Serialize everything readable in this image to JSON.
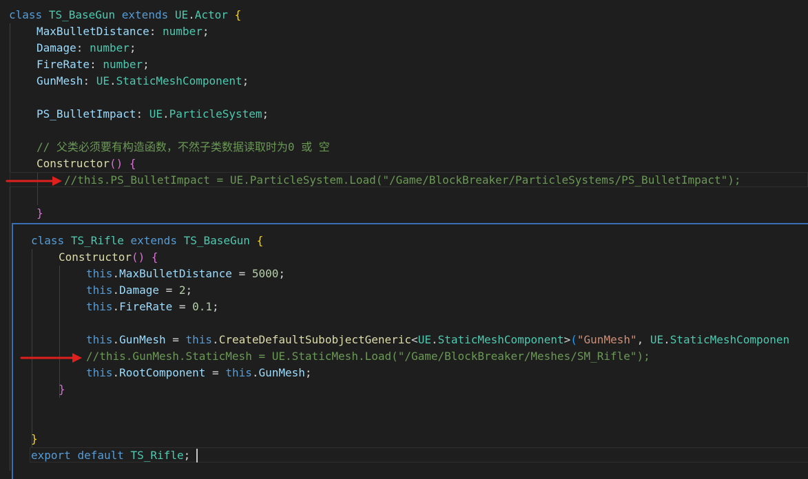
{
  "editor": {
    "outer": {
      "l1": {
        "kw_class": "class",
        "name": "TS_BaseGun",
        "kw_extends": "extends",
        "ns": "UE",
        "dot": ".",
        "base": "Actor",
        "brace": "{"
      },
      "l2": {
        "prop": "MaxBulletDistance",
        "colon": ": ",
        "type": "number",
        "semi": ";"
      },
      "l3": {
        "prop": "Damage",
        "colon": ": ",
        "type": "number",
        "semi": ";"
      },
      "l4": {
        "prop": "FireRate",
        "colon": ": ",
        "type": "number",
        "semi": ";"
      },
      "l5": {
        "prop": "GunMesh",
        "colon": ": ",
        "ns": "UE",
        "dot": ".",
        "type": "StaticMeshComponent",
        "semi": ";"
      },
      "l6": {
        "prop": "PS_BulletImpact",
        "colon": ": ",
        "ns": "UE",
        "dot": ".",
        "type": "ParticleSystem",
        "semi": ";"
      },
      "l7": {
        "comment": "// 父类必须要有构造函数，不然子类数据读取时为0 或 空"
      },
      "l8": {
        "fn": "Constructor",
        "parens": "()",
        "sp": " ",
        "brace": "{"
      },
      "l9": {
        "comment": "//this.PS_BulletImpact = UE.ParticleSystem.Load(\"/Game/BlockBreaker/ParticleSystems/PS_BulletImpact\");"
      },
      "l10": {
        "brace": "}"
      }
    },
    "inline": {
      "l1": {
        "kw_class": "class",
        "name": "TS_Rifle",
        "kw_extends": "extends",
        "base": "TS_BaseGun",
        "brace": "{"
      },
      "l2": {
        "fn": "Constructor",
        "parens": "()",
        "sp": " ",
        "brace": "{"
      },
      "l3": {
        "this": "this",
        "dot": ".",
        "prop": "MaxBulletDistance",
        "eq": " = ",
        "num": "5000",
        "semi": ";"
      },
      "l4": {
        "this": "this",
        "dot": ".",
        "prop": "Damage",
        "eq": " = ",
        "num": "2",
        "semi": ";"
      },
      "l5": {
        "this": "this",
        "dot": ".",
        "prop": "FireRate",
        "eq": " = ",
        "num": "0.1",
        "semi": ";"
      },
      "l6": {
        "this": "this",
        "dot": ".",
        "prop": "GunMesh",
        "eq": " = ",
        "this2": "this",
        "dot2": ".",
        "fn": "CreateDefaultSubobjectGeneric",
        "lt": "<",
        "ns": "UE",
        "dot3": ".",
        "type": "StaticMeshComponent",
        "gt": ">",
        "paren": "(",
        "str": "\"GunMesh\"",
        "comma": ", ",
        "ns2": "UE",
        "dot4": ".",
        "type2": "StaticMeshComponen"
      },
      "l7": {
        "comment": "//this.GunMesh.StaticMesh = UE.StaticMesh.Load(\"/Game/BlockBreaker/Meshes/SM_Rifle\");"
      },
      "l8": {
        "this": "this",
        "dot": ".",
        "prop": "RootComponent",
        "eq": " = ",
        "this2": "this",
        "dot2": ".",
        "prop2": "GunMesh",
        "semi": ";"
      },
      "l9": {
        "brace": "}"
      },
      "l10": {
        "brace": "}"
      },
      "l11": {
        "kw_export": "export",
        "kw_default": "default",
        "name": "TS_Rifle",
        "semi": ";"
      }
    }
  },
  "colors": {
    "background": "#1e1e1e",
    "keyword": "#569cd6",
    "class": "#4ec9b0",
    "property": "#9cdcfe",
    "function": "#dcdcaa",
    "number": "#b5cea8",
    "string": "#ce9178",
    "comment": "#6a9955",
    "bracket1": "#ffd700",
    "bracket2": "#da70d6",
    "bracket3": "#179fff",
    "arrow": "#e0201c",
    "panel_border": "#3b6fb5"
  }
}
